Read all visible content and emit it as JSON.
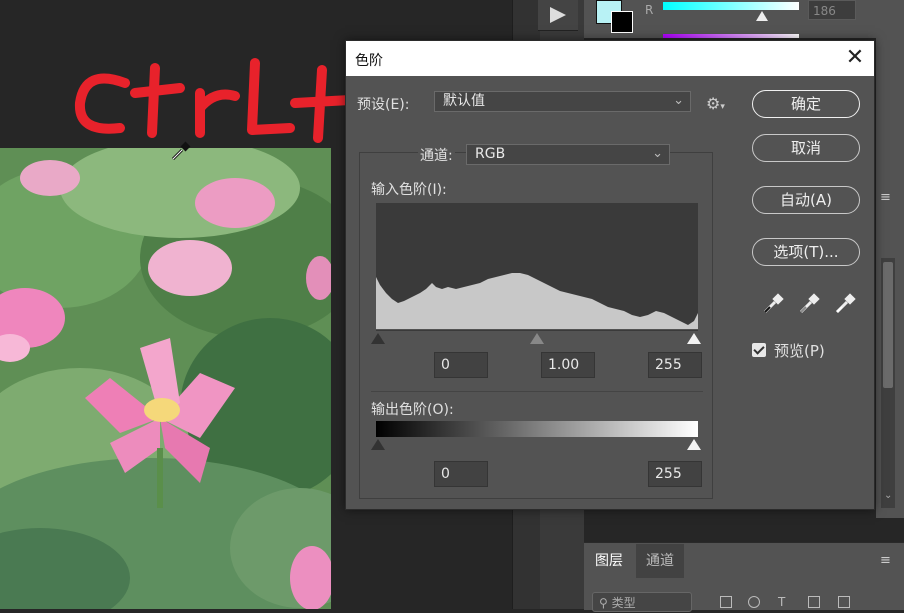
{
  "colors": {
    "workspace_bg": "#262626",
    "panel_bg": "#535353",
    "dialog_bg": "#535353",
    "titlebar_bg": "#ffffff",
    "annotation_red": "#e8222b",
    "foreground_swatch": "#b8f2f5",
    "background_swatch": "#000000"
  },
  "annotation": {
    "text": "Ctrl+L"
  },
  "color_panel": {
    "channel_label": "R",
    "channel_value": "186"
  },
  "layers_panel": {
    "tabs": [
      {
        "label": "图层"
      },
      {
        "label": "通道"
      }
    ],
    "search_placeholder": "类型"
  },
  "dialog": {
    "title": "色阶",
    "preset": {
      "label": "预设(E):",
      "value": "默认值"
    },
    "channel": {
      "label": "通道:",
      "value": "RGB"
    },
    "input_levels": {
      "label": "输入色阶(I):",
      "black": "0",
      "gamma": "1.00",
      "white": "255"
    },
    "output_levels": {
      "label": "输出色阶(O):",
      "black": "0",
      "white": "255"
    },
    "buttons": {
      "ok": "确定",
      "cancel": "取消",
      "auto": "自动(A)",
      "options": "选项(T)..."
    },
    "preview": {
      "label": "预览(P)",
      "checked": true
    },
    "icons": {
      "close": "close-icon",
      "gear": "gear-icon",
      "droppers": [
        "black-point-eyedropper-icon",
        "gray-point-eyedropper-icon",
        "white-point-eyedropper-icon"
      ]
    }
  }
}
